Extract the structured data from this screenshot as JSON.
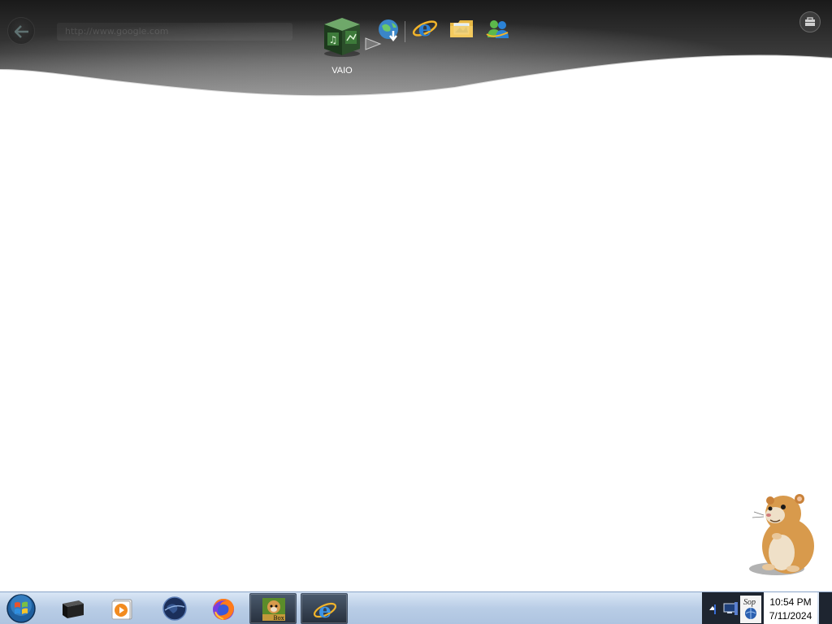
{
  "dock": {
    "address_text": "http://www.google.com",
    "vaio_label": "VAIO",
    "items": [
      {
        "icon": "vaio-media-cube-icon"
      },
      {
        "icon": "globe-download-icon"
      },
      {
        "icon": "internet-explorer-icon"
      },
      {
        "icon": "folder-photos-icon"
      },
      {
        "icon": "messenger-people-icon"
      }
    ],
    "toolbox_icon": "toolbox-icon",
    "back_icon": "back-arrow-icon"
  },
  "taskbar": {
    "start_icon": "windows-start-orb-icon",
    "apps": [
      {
        "icon": "black-device-icon"
      },
      {
        "icon": "media-player-icon"
      },
      {
        "icon": "dark-globe-icon"
      },
      {
        "icon": "firefox-icon"
      },
      {
        "icon": "hamster-box-icon",
        "label": "Box"
      },
      {
        "icon": "internet-explorer-icon"
      }
    ],
    "tray": {
      "icons": [
        "show-hidden-icons-icon",
        "network-monitor-icon",
        "sop-icon",
        "network-globe-icon"
      ],
      "sop_text": "Sop",
      "time": "10:54 PM",
      "date": "7/11/2024"
    }
  },
  "colors": {
    "dock_dark": "#1c1c1c",
    "taskbar_light": "#c8d8ee",
    "ie_blue": "#2a7fd4"
  }
}
